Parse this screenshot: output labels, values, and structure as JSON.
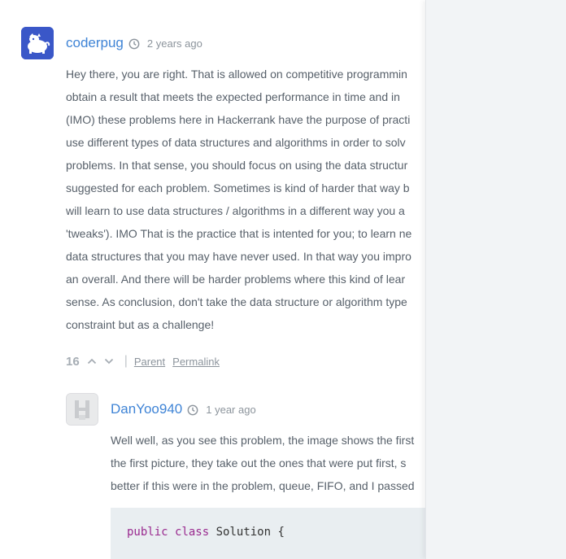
{
  "top_fragment": "",
  "comments": [
    {
      "username": "coderpug",
      "time": "2 years ago",
      "lines": [
        "Hey there, you are right. That is allowed on competitive programmin",
        "obtain a result that meets the expected performance in time and in",
        "(IMO) these problems here in Hackerrank have the purpose of practi",
        "use different types of data structures and algorithms in order to solv",
        "problems. In that sense, you should focus on using the data structur",
        "suggested for each problem. Sometimes is kind of harder that way b",
        "will learn to use data structures / algorithms in a different way you a",
        "'tweaks'). IMO That is the practice that is intented for you; to learn ne",
        "data structures that you may have never used. In that way you impro",
        "an overall. And there will be harder problems where this kind of lear",
        "sense. As conclusion, don't take the data structure or algorithm type",
        "constraint but as a challenge!"
      ],
      "votes": "16",
      "parent_label": "Parent",
      "permalink_label": "Permalink"
    },
    {
      "username": "DanYoo940",
      "time": "1 year ago",
      "lines": [
        "Well well, as you see this problem, the image shows the first",
        "the first picture, they take out the ones that were put first, s",
        "better if this were in the problem, queue, FIFO, and I passed"
      ],
      "code": {
        "kw1": "public",
        "kw2": "class",
        "rest": " Solution {"
      }
    }
  ],
  "icons": {
    "clock": "clock-icon",
    "upvote": "chevron-up-icon",
    "downvote": "chevron-down-icon"
  },
  "colors": {
    "username": "#3f84d6",
    "body_text": "#57606a",
    "avatar_pug_bg": "#3a57c8",
    "code_bg": "#e9eef1",
    "code_keyword": "#9a2a8f",
    "side_panel": "#f2f4f6"
  }
}
